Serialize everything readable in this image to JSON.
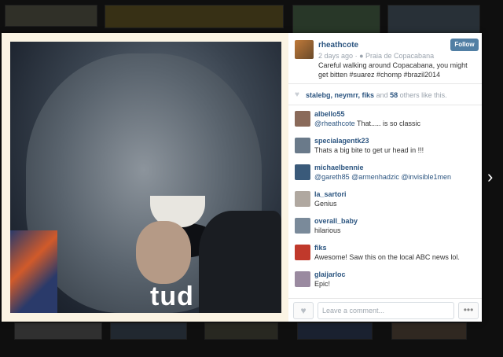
{
  "post": {
    "username": "rheathcote",
    "follow_label": "Follow",
    "time": "2 days ago",
    "location": "Praia de Copacabana",
    "caption": "Careful walking around Copacabana, you might get bitten #suarez #chomp #brazil2014",
    "photo_text": "tud"
  },
  "likes": {
    "users": "stalebg, neymrr, fiks",
    "connector": "and",
    "count": "58",
    "suffix": "others like this."
  },
  "comments": [
    {
      "user": "albello55",
      "mention": "@rheathcote",
      "text": " That..... is so classic",
      "avatar_color": "#8a6a5a"
    },
    {
      "user": "specialagentk23",
      "mention": "",
      "text": "Thats a big bite to get ur head in !!!",
      "avatar_color": "#6a7a8a"
    },
    {
      "user": "michaelbennie",
      "mention": "@gareth85 @armenhadzic @invisible1men",
      "text": "",
      "avatar_color": "#3a5a7a"
    },
    {
      "user": "la_sartori",
      "mention": "",
      "text": "Genius",
      "avatar_color": "#b0a8a0"
    },
    {
      "user": "overall_baby",
      "mention": "",
      "text": "hilarious",
      "avatar_color": "#7a8a9a"
    },
    {
      "user": "fiks",
      "mention": "",
      "text": "Awesome! Saw this on the local ABC news lol.",
      "avatar_color": "#c0392b"
    },
    {
      "user": "glaijarloc",
      "mention": "",
      "text": "Epic!",
      "avatar_color": "#9a8aa0"
    }
  ],
  "footer": {
    "comment_placeholder": "Leave a comment...",
    "more_label": "•••"
  }
}
